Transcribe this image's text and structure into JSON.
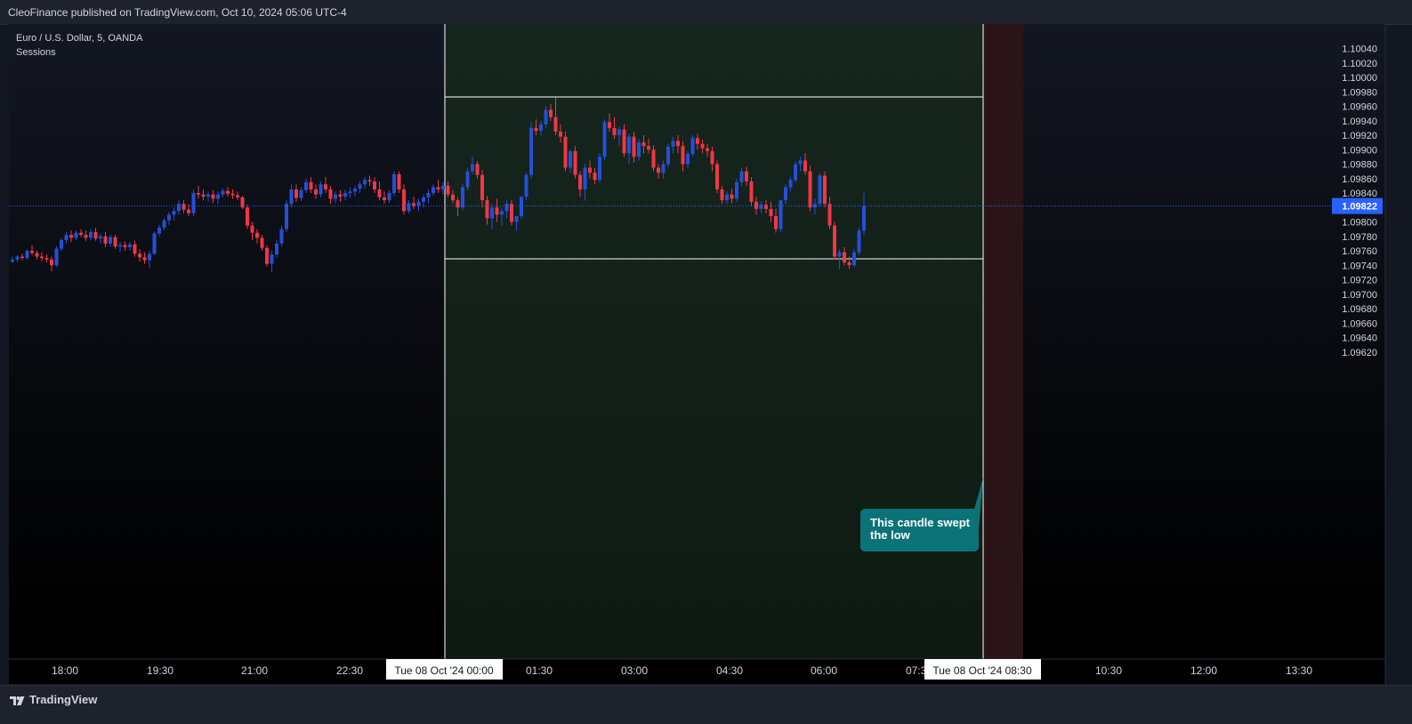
{
  "header": {
    "publisher": "CleoFinance published on TradingView.com, Oct 10, 2024 05:06 UTC-4"
  },
  "legend": {
    "symbol": "Euro / U.S. Dollar, 5, OANDA",
    "indicator": "Sessions"
  },
  "footer": {
    "brand": "TradingView"
  },
  "colors": {
    "up": "#2450d8",
    "down": "#f23645",
    "background": "#131722",
    "session_fill": "#13261d",
    "killzone_fill": "#2a1418",
    "price_line": "#2962ff",
    "annotation": "#0b7377"
  },
  "chart_data": {
    "type": "candlestick",
    "ylim": [
      1.0962,
      1.1005
    ],
    "y_ticks": [
      "1.10040",
      "1.10020",
      "1.10000",
      "1.09980",
      "1.09960",
      "1.09940",
      "1.09920",
      "1.09900",
      "1.09880",
      "1.09860",
      "1.09840",
      "1.09800",
      "1.09780",
      "1.09760",
      "1.09740",
      "1.09720",
      "1.09700",
      "1.09680",
      "1.09660",
      "1.09640",
      "1.09620"
    ],
    "x_ticks": [
      "18:00",
      "19:30",
      "21:00",
      "22:30",
      "01:30",
      "03:00",
      "04:30",
      "06:00",
      "07:30",
      "10:30",
      "12:00",
      "13:30"
    ],
    "current_price": "1.09822",
    "session_start_label": "Tue 08 Oct '24   00:00",
    "session_end_label": "Tue 08 Oct '24   08:30",
    "session_high": 1.09973,
    "session_low": 1.09749,
    "annotation": "This candle swept the low",
    "candles": [
      [
        1.09745,
        1.09752,
        1.09743,
        1.09748
      ],
      [
        1.09748,
        1.09754,
        1.09744,
        1.09752
      ],
      [
        1.09752,
        1.09756,
        1.09747,
        1.0975
      ],
      [
        1.0975,
        1.09762,
        1.09748,
        1.0976
      ],
      [
        1.0976,
        1.09768,
        1.09754,
        1.09757
      ],
      [
        1.09757,
        1.0976,
        1.09748,
        1.09752
      ],
      [
        1.09752,
        1.09758,
        1.09746,
        1.0975
      ],
      [
        1.0975,
        1.09755,
        1.09744,
        1.09748
      ],
      [
        1.09748,
        1.09752,
        1.09732,
        1.0974
      ],
      [
        1.0974,
        1.09766,
        1.09738,
        1.09763
      ],
      [
        1.09763,
        1.09778,
        1.0976,
        1.09775
      ],
      [
        1.09775,
        1.09786,
        1.0977,
        1.09782
      ],
      [
        1.09782,
        1.09788,
        1.09772,
        1.09778
      ],
      [
        1.09778,
        1.09788,
        1.09775,
        1.09785
      ],
      [
        1.09785,
        1.0979,
        1.09779,
        1.09782
      ],
      [
        1.09782,
        1.09788,
        1.09774,
        1.09778
      ],
      [
        1.09778,
        1.0979,
        1.09775,
        1.09786
      ],
      [
        1.09786,
        1.09792,
        1.09774,
        1.09777
      ],
      [
        1.09777,
        1.09784,
        1.0977,
        1.0978
      ],
      [
        1.0978,
        1.09786,
        1.09765,
        1.0977
      ],
      [
        1.0977,
        1.09782,
        1.09766,
        1.09779
      ],
      [
        1.09779,
        1.09782,
        1.09763,
        1.09766
      ],
      [
        1.09766,
        1.09772,
        1.09758,
        1.09768
      ],
      [
        1.09768,
        1.09773,
        1.0976,
        1.09765
      ],
      [
        1.09765,
        1.09772,
        1.0976,
        1.09769
      ],
      [
        1.09769,
        1.09774,
        1.09752,
        1.09756
      ],
      [
        1.09756,
        1.09762,
        1.09745,
        1.09751
      ],
      [
        1.09751,
        1.09758,
        1.09742,
        1.09747
      ],
      [
        1.09747,
        1.0976,
        1.09736,
        1.09756
      ],
      [
        1.09756,
        1.09787,
        1.09754,
        1.09784
      ],
      [
        1.09784,
        1.09796,
        1.0978,
        1.09792
      ],
      [
        1.09792,
        1.09805,
        1.09788,
        1.09802
      ],
      [
        1.09802,
        1.09814,
        1.09796,
        1.0981
      ],
      [
        1.0981,
        1.0982,
        1.09802,
        1.09815
      ],
      [
        1.09815,
        1.0983,
        1.0981,
        1.09825
      ],
      [
        1.09825,
        1.0983,
        1.09812,
        1.09817
      ],
      [
        1.09817,
        1.09825,
        1.09808,
        1.09812
      ],
      [
        1.09812,
        1.09845,
        1.09808,
        1.0984
      ],
      [
        1.0984,
        1.0985,
        1.09832,
        1.09838
      ],
      [
        1.09838,
        1.09845,
        1.0983,
        1.09835
      ],
      [
        1.09835,
        1.09842,
        1.09828,
        1.09838
      ],
      [
        1.09838,
        1.09844,
        1.09826,
        1.09832
      ],
      [
        1.09832,
        1.09842,
        1.09825,
        1.09838
      ],
      [
        1.09838,
        1.09846,
        1.09834,
        1.09843
      ],
      [
        1.09843,
        1.09848,
        1.09835,
        1.09839
      ],
      [
        1.09839,
        1.09845,
        1.09832,
        1.09837
      ],
      [
        1.09837,
        1.09842,
        1.0983,
        1.09834
      ],
      [
        1.09834,
        1.09836,
        1.09818,
        1.0982
      ],
      [
        1.0982,
        1.09824,
        1.0979,
        1.09795
      ],
      [
        1.09795,
        1.098,
        1.09775,
        1.09785
      ],
      [
        1.09785,
        1.0979,
        1.0977,
        1.09778
      ],
      [
        1.09778,
        1.09782,
        1.0976,
        1.09764
      ],
      [
        1.09764,
        1.09768,
        1.09738,
        1.09742
      ],
      [
        1.09742,
        1.0976,
        1.0973,
        1.09755
      ],
      [
        1.09755,
        1.09775,
        1.0975,
        1.0977
      ],
      [
        1.0977,
        1.09795,
        1.09766,
        1.0979
      ],
      [
        1.0979,
        1.0983,
        1.09786,
        1.09825
      ],
      [
        1.09825,
        1.09852,
        1.0982,
        1.09845
      ],
      [
        1.09845,
        1.09852,
        1.09828,
        1.09833
      ],
      [
        1.09833,
        1.09848,
        1.09829,
        1.09844
      ],
      [
        1.09844,
        1.0986,
        1.0984,
        1.09855
      ],
      [
        1.09855,
        1.09862,
        1.0984,
        1.09845
      ],
      [
        1.09845,
        1.09852,
        1.09832,
        1.09838
      ],
      [
        1.09838,
        1.09856,
        1.09834,
        1.09852
      ],
      [
        1.09852,
        1.09862,
        1.0984,
        1.09845
      ],
      [
        1.09845,
        1.0985,
        1.09825,
        1.09832
      ],
      [
        1.09832,
        1.09842,
        1.09826,
        1.09838
      ],
      [
        1.09838,
        1.09844,
        1.09828,
        1.09835
      ],
      [
        1.09835,
        1.09845,
        1.0983,
        1.0984
      ],
      [
        1.0984,
        1.09848,
        1.09834,
        1.09842
      ],
      [
        1.09842,
        1.0985,
        1.09836,
        1.09846
      ],
      [
        1.09846,
        1.09856,
        1.0984,
        1.09852
      ],
      [
        1.09852,
        1.09862,
        1.09846,
        1.09858
      ],
      [
        1.09858,
        1.09864,
        1.0985,
        1.09856
      ],
      [
        1.09856,
        1.09862,
        1.0984,
        1.09845
      ],
      [
        1.09845,
        1.09856,
        1.0983,
        1.09834
      ],
      [
        1.09834,
        1.09842,
        1.09825,
        1.0983
      ],
      [
        1.0983,
        1.09844,
        1.09826,
        1.0984
      ],
      [
        1.0984,
        1.0987,
        1.09836,
        1.09866
      ],
      [
        1.09866,
        1.0987,
        1.0984,
        1.09845
      ],
      [
        1.09845,
        1.09852,
        1.0981,
        1.09815
      ],
      [
        1.09815,
        1.0983,
        1.09812,
        1.09826
      ],
      [
        1.09826,
        1.09835,
        1.09818,
        1.09822
      ],
      [
        1.09822,
        1.09832,
        1.09815,
        1.09828
      ],
      [
        1.09828,
        1.09838,
        1.0982,
        1.09834
      ],
      [
        1.09834,
        1.09845,
        1.09826,
        1.0984
      ],
      [
        1.0984,
        1.09852,
        1.09836,
        1.09848
      ],
      [
        1.09848,
        1.09858,
        1.0984,
        1.09845
      ],
      [
        1.09845,
        1.09855,
        1.09838,
        1.0985
      ],
      [
        1.0985,
        1.09856,
        1.09834,
        1.09838
      ],
      [
        1.09838,
        1.09844,
        1.09826,
        1.0983
      ],
      [
        1.0983,
        1.09834,
        1.09808,
        1.0982
      ],
      [
        1.0982,
        1.09852,
        1.09816,
        1.09848
      ],
      [
        1.09848,
        1.09875,
        1.09844,
        1.0987
      ],
      [
        1.0987,
        1.0989,
        1.09866,
        1.0988
      ],
      [
        1.0988,
        1.09884,
        1.0986,
        1.09865
      ],
      [
        1.09865,
        1.09872,
        1.0982,
        1.0983
      ],
      [
        1.0983,
        1.09836,
        1.09796,
        1.09805
      ],
      [
        1.09805,
        1.09825,
        1.0979,
        1.0982
      ],
      [
        1.0982,
        1.09832,
        1.098,
        1.0981
      ],
      [
        1.0981,
        1.0982,
        1.09795,
        1.09815
      ],
      [
        1.09815,
        1.0983,
        1.09805,
        1.09825
      ],
      [
        1.09825,
        1.0983,
        1.09795,
        1.098
      ],
      [
        1.098,
        1.09808,
        1.09788,
        1.09808
      ],
      [
        1.09808,
        1.09825,
        1.09804,
        1.09835
      ],
      [
        1.09835,
        1.09868,
        1.0983,
        1.09865
      ],
      [
        1.09865,
        1.09938,
        1.0986,
        1.0993
      ],
      [
        1.0993,
        1.09942,
        1.0992,
        1.09926
      ],
      [
        1.09926,
        1.0994,
        1.0992,
        1.09935
      ],
      [
        1.09935,
        1.0996,
        1.0993,
        1.09955
      ],
      [
        1.09955,
        1.09963,
        1.0994,
        1.09945
      ],
      [
        1.09945,
        1.09972,
        1.0992,
        1.09925
      ],
      [
        1.09925,
        1.09935,
        1.0991,
        1.09918
      ],
      [
        1.09918,
        1.09925,
        1.0987,
        1.09875
      ],
      [
        1.09875,
        1.099,
        1.09868,
        1.09898
      ],
      [
        1.09898,
        1.09905,
        1.0986,
        1.09865
      ],
      [
        1.09865,
        1.0987,
        1.09835,
        1.09845
      ],
      [
        1.09845,
        1.0988,
        1.0983,
        1.09875
      ],
      [
        1.09875,
        1.09885,
        1.0986,
        1.09868
      ],
      [
        1.09868,
        1.09875,
        1.09852,
        1.09858
      ],
      [
        1.09858,
        1.09895,
        1.09854,
        1.0989
      ],
      [
        1.0989,
        1.09942,
        1.09885,
        1.09938
      ],
      [
        1.09938,
        1.0995,
        1.09925,
        1.0993
      ],
      [
        1.0993,
        1.09945,
        1.09915,
        1.0992
      ],
      [
        1.0992,
        1.09932,
        1.09905,
        1.09928
      ],
      [
        1.09928,
        1.09935,
        1.0989,
        1.09895
      ],
      [
        1.09895,
        1.09922,
        1.0988,
        1.09918
      ],
      [
        1.09918,
        1.09925,
        1.09882,
        1.0989
      ],
      [
        1.0989,
        1.09915,
        1.09885,
        1.0991
      ],
      [
        1.0991,
        1.0992,
        1.09895,
        1.09905
      ],
      [
        1.09905,
        1.09915,
        1.09895,
        1.099
      ],
      [
        1.099,
        1.09906,
        1.0987,
        1.09875
      ],
      [
        1.09875,
        1.0988,
        1.0986,
        1.09868
      ],
      [
        1.09868,
        1.09885,
        1.0986,
        1.0988
      ],
      [
        1.0988,
        1.09908,
        1.09876,
        1.09904
      ],
      [
        1.09904,
        1.09918,
        1.09895,
        1.09912
      ],
      [
        1.09912,
        1.0992,
        1.09895,
        1.09905
      ],
      [
        1.09905,
        1.09912,
        1.0987,
        1.0988
      ],
      [
        1.0988,
        1.09898,
        1.09875,
        1.09894
      ],
      [
        1.09894,
        1.0992,
        1.0989,
        1.09916
      ],
      [
        1.09916,
        1.09922,
        1.099,
        1.09908
      ],
      [
        1.09908,
        1.09914,
        1.09895,
        1.09902
      ],
      [
        1.09902,
        1.09908,
        1.0989,
        1.09898
      ],
      [
        1.09898,
        1.09904,
        1.0987,
        1.0988
      ],
      [
        1.0988,
        1.09885,
        1.0984,
        1.09845
      ],
      [
        1.09845,
        1.0985,
        1.09825,
        1.0983
      ],
      [
        1.0983,
        1.09842,
        1.09825,
        1.09838
      ],
      [
        1.09838,
        1.09846,
        1.09826,
        1.09832
      ],
      [
        1.09832,
        1.0986,
        1.09828,
        1.09855
      ],
      [
        1.09855,
        1.09875,
        1.0985,
        1.0987
      ],
      [
        1.0987,
        1.09876,
        1.0985,
        1.09856
      ],
      [
        1.09856,
        1.09862,
        1.09822,
        1.09828
      ],
      [
        1.09828,
        1.09835,
        1.0981,
        1.09818
      ],
      [
        1.09818,
        1.09828,
        1.09812,
        1.09824
      ],
      [
        1.09824,
        1.0983,
        1.09812,
        1.09818
      ],
      [
        1.09818,
        1.09828,
        1.098,
        1.09808
      ],
      [
        1.09808,
        1.09818,
        1.09785,
        1.0979
      ],
      [
        1.0979,
        1.0982,
        1.09786,
        1.0983
      ],
      [
        1.0983,
        1.09852,
        1.09825,
        1.09848
      ],
      [
        1.09848,
        1.09862,
        1.09842,
        1.09858
      ],
      [
        1.09858,
        1.09884,
        1.09854,
        1.0988
      ],
      [
        1.0988,
        1.0989,
        1.0987,
        1.09885
      ],
      [
        1.09885,
        1.09895,
        1.09865,
        1.0987
      ],
      [
        1.0987,
        1.09878,
        1.09815,
        1.0982
      ],
      [
        1.0982,
        1.09832,
        1.0981,
        1.09825
      ],
      [
        1.09825,
        1.09868,
        1.09822,
        1.09864
      ],
      [
        1.09864,
        1.0987,
        1.0982,
        1.09825
      ],
      [
        1.09825,
        1.09835,
        1.0979,
        1.09795
      ],
      [
        1.09795,
        1.098,
        1.09748,
        1.09752
      ],
      [
        1.09752,
        1.09762,
        1.09735,
        1.09758
      ],
      [
        1.09758,
        1.09765,
        1.0974,
        1.09744
      ],
      [
        1.09744,
        1.09752,
        1.09735,
        1.0974
      ],
      [
        1.0974,
        1.09762,
        1.09738,
        1.09758
      ],
      [
        1.09758,
        1.09792,
        1.09754,
        1.09788
      ],
      [
        1.09788,
        1.0984,
        1.09782,
        1.09822
      ]
    ]
  }
}
